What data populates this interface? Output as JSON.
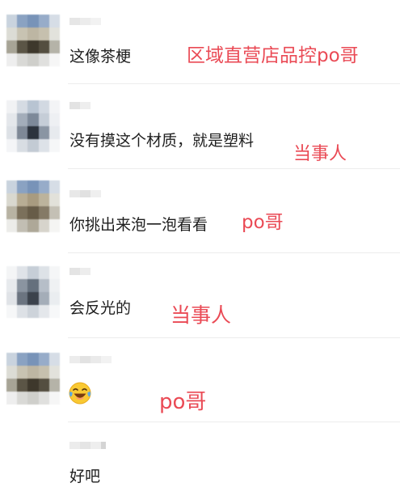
{
  "comments": [
    {
      "text": "这像茶梗",
      "note": "区域直营店品控po哥"
    },
    {
      "text": "没有摸这个材质，就是塑料",
      "note": "当事人"
    },
    {
      "text": "你挑出来泡一泡看看",
      "note": "po哥"
    },
    {
      "text": "会反光的",
      "note": "当事人"
    },
    {
      "text": "",
      "emoji": "laughing-with-tears-emoji",
      "note": "po哥"
    },
    {
      "text": "好吧",
      "note": ""
    }
  ],
  "colors": {
    "annotation": "#ea4a55",
    "text": "#1f1f1f",
    "divider": "#ececec"
  }
}
